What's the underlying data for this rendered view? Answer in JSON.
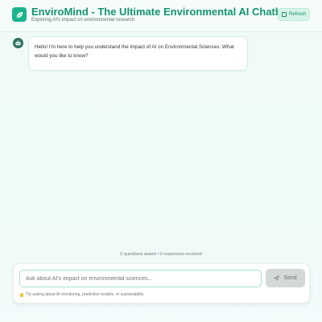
{
  "header": {
    "title": "EnviroMind - The Ultimate Environmental AI Chatbot",
    "subtitle": "Exploring AI's impact on environmental research",
    "refresh_label": "Refresh"
  },
  "chat": {
    "messages": [
      {
        "role": "bot",
        "text": "Hello! I'm here to help you understand the impact of AI on Environmental Sciences. What would you like to know?"
      }
    ]
  },
  "stats": {
    "text": "0 questions asked • 0 responses received"
  },
  "composer": {
    "placeholder": "Ask about AI's impact on environmental sciences...",
    "value": "",
    "send_label": "Send",
    "hint": "Try asking about AI monitoring, predictive models, or sustainability"
  },
  "colors": {
    "accent": "#19b58a",
    "title": "#12946f",
    "send_disabled": "#d3d9d8"
  }
}
